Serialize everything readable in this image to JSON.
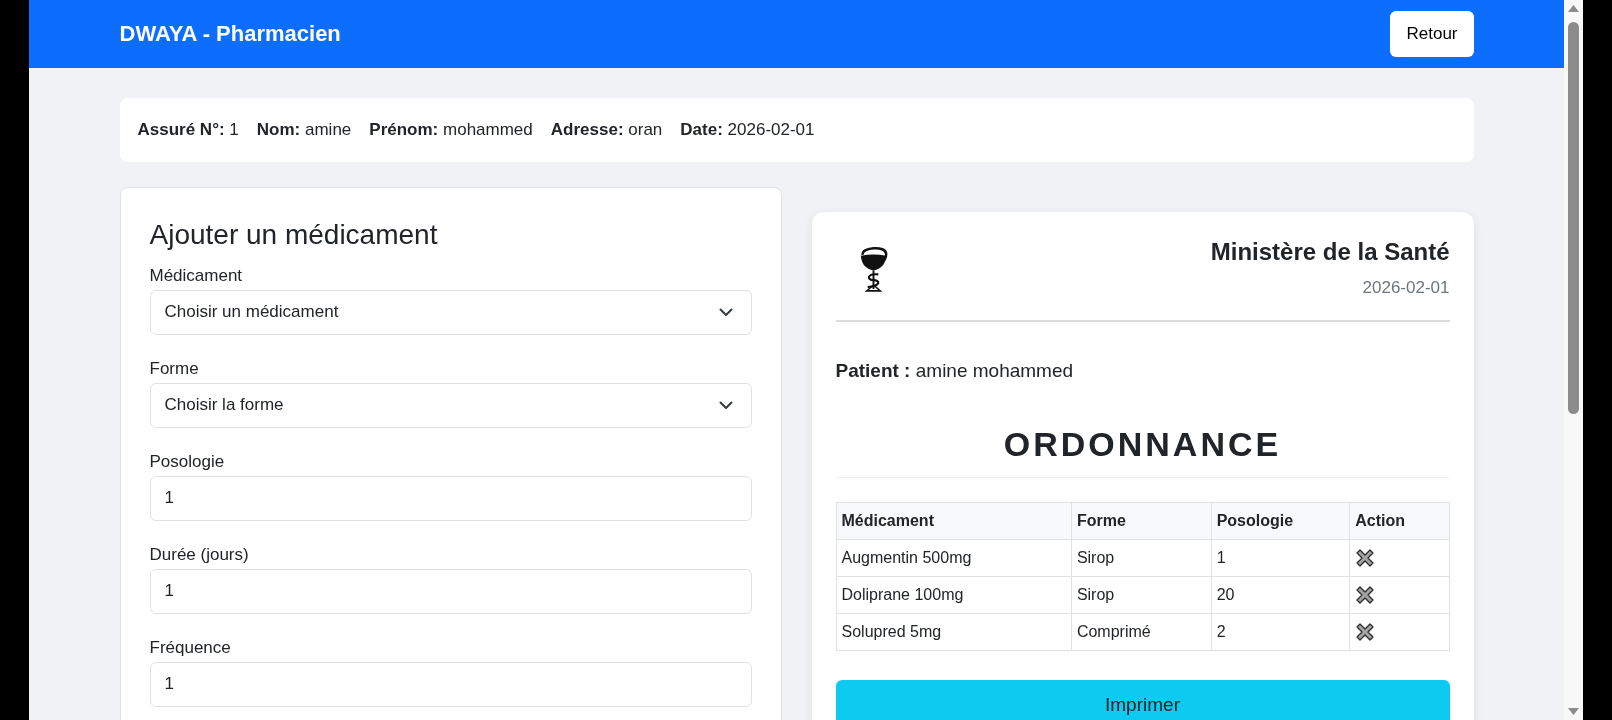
{
  "header": {
    "title": "DWAYA - Pharmacien",
    "back_button": "Retour"
  },
  "patient_info": [
    {
      "label": "Assuré N°:",
      "value": "1"
    },
    {
      "label": "Nom:",
      "value": "amine"
    },
    {
      "label": "Prénom:",
      "value": "mohammed"
    },
    {
      "label": "Adresse:",
      "value": "oran"
    },
    {
      "label": "Date:",
      "value": "2026-02-01"
    }
  ],
  "add_form": {
    "title": "Ajouter un médicament",
    "fields": [
      {
        "kind": "select",
        "label": "Médicament",
        "value": "Choisir un médicament"
      },
      {
        "kind": "select",
        "label": "Forme",
        "value": "Choisir la forme"
      },
      {
        "kind": "number",
        "label": "Posologie",
        "value": "1"
      },
      {
        "kind": "number",
        "label": "Durée (jours)",
        "value": "1"
      },
      {
        "kind": "number",
        "label": "Fréquence",
        "value": "1"
      }
    ]
  },
  "prescription": {
    "authority": "Ministère de la Santé",
    "date": "2026-02-01",
    "patient": {
      "label": "Patient :",
      "value": "amine mohammed"
    },
    "title": "ORDONNANCE",
    "table": {
      "columns": [
        "Médicament",
        "Forme",
        "Posologie",
        "Action"
      ],
      "rows": [
        [
          "Augmentin 500mg",
          "Sirop",
          "1"
        ],
        [
          "Doliprane 100mg",
          "Sirop",
          "20"
        ],
        [
          "Solupred 5mg",
          "Comprimé",
          "2"
        ]
      ]
    },
    "print_button": "Imprimer"
  }
}
